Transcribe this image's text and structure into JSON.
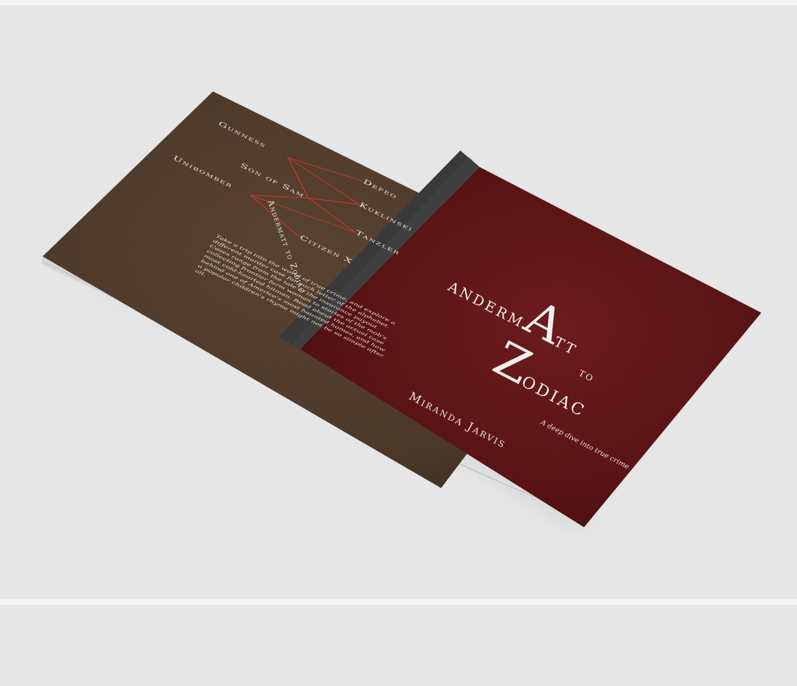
{
  "back_cover": {
    "names": [
      "Gunness",
      "Defeo",
      "Son of Sam",
      "Kuklinski",
      "Unibomber",
      "Tanzler",
      "Citizen X"
    ],
    "blurb": "Take a trip into the world of true crime, and explore a different murder case for each letter of the alphabet. Cases range from the tale of the insurance payout collecting frontier farm woman to stories of the mob's most cold-hearted hitman. Read about the actual case behind one of America's most haunted homes, and how a popular children's rhyme might not be so simple after all."
  },
  "spine": {
    "text": "Andermatt to Zodiac"
  },
  "front_cover": {
    "title_pre": "anderm",
    "title_big_a": "A",
    "title_post": "tt",
    "title_to": "to",
    "title_big_z": "Z",
    "title_z_rest": "odiac",
    "subtitle": "A deep dive into true crime",
    "author": "Miranda Jarvis"
  },
  "colors": {
    "background": "#e6e6e6",
    "back_cover": "#5b4434",
    "front_cover": "#6e1a1c",
    "spine": "#3b3b3b",
    "connector_line": "#d8332e"
  }
}
